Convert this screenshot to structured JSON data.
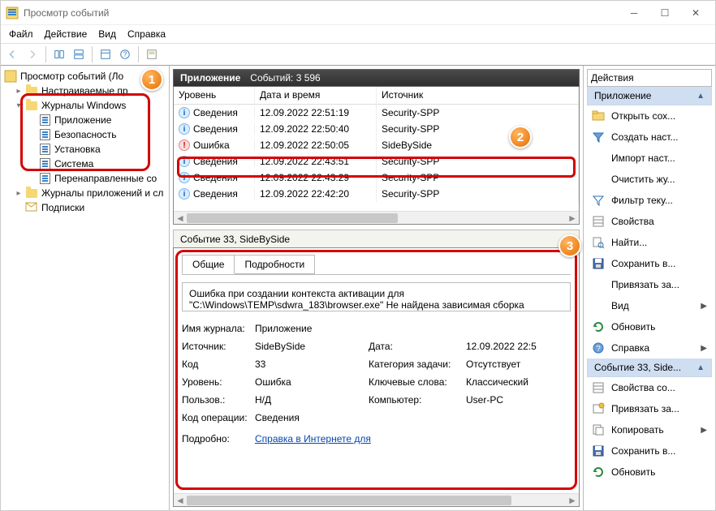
{
  "window": {
    "title": "Просмотр событий"
  },
  "menu": [
    "Файл",
    "Действие",
    "Вид",
    "Справка"
  ],
  "tree": {
    "root": "Просмотр событий (Ло",
    "custom": "Настраиваемые пр",
    "winlogs": "Журналы Windows",
    "items": [
      "Приложение",
      "Безопасность",
      "Установка",
      "Система",
      "Перенаправленные сo"
    ],
    "applogs": "Журналы приложений и сл",
    "subs": "Подписки"
  },
  "center": {
    "title": "Приложение",
    "event_count": "Событий: 3 596",
    "columns": [
      "Уровень",
      "Дата и время",
      "Источник"
    ],
    "rows": [
      {
        "level": "Сведения",
        "lvl": "info",
        "dt": "12.09.2022 22:51:19",
        "src": "Security-SPP"
      },
      {
        "level": "Сведения",
        "lvl": "info",
        "dt": "12.09.2022 22:50:40",
        "src": "Security-SPP"
      },
      {
        "level": "Ошибка",
        "lvl": "err",
        "dt": "12.09.2022 22:50:05",
        "src": "SideBySide"
      },
      {
        "level": "Сведения",
        "lvl": "info",
        "dt": "12.09.2022 22:43:51",
        "src": "Security-SPP"
      },
      {
        "level": "Сведения",
        "lvl": "info",
        "dt": "12.09.2022 22:43:29",
        "src": "Security-SPP"
      },
      {
        "level": "Сведения",
        "lvl": "info",
        "dt": "12.09.2022 22:42:20",
        "src": "Security-SPP"
      }
    ],
    "detail_title": "Событие 33, SideBySide",
    "tabs": [
      "Общие",
      "Подробности"
    ],
    "err_text": "Ошибка при создании контекста активации для \"C:\\Windows\\TEMP\\sdwra_183\\browser.exe\"  Не найдена зависимая сборка",
    "props": [
      [
        "Имя журнала:",
        "Приложение",
        "",
        ""
      ],
      [
        "Источник:",
        "SideBySide",
        "Дата:",
        "12.09.2022 22:5"
      ],
      [
        "Код",
        "33",
        "Категория задачи:",
        "Отсутствует"
      ],
      [
        "Уровень:",
        "Ошибка",
        "Ключевые слова:",
        "Классический"
      ],
      [
        "Пользов.:",
        "Н/Д",
        "Компьютер:",
        "User-PC"
      ],
      [
        "Код операции:",
        "Сведения",
        "",
        ""
      ]
    ],
    "help_label": "Подробно:",
    "help_link": "Справка в Интернете для"
  },
  "actions": {
    "title": "Действия",
    "sec1": "Приложение",
    "items1": [
      {
        "icon": "folder",
        "label": "Открыть сох..."
      },
      {
        "icon": "filter",
        "label": "Создать наст..."
      },
      {
        "icon": "blank",
        "label": "Импорт наст..."
      },
      {
        "icon": "blank",
        "label": "Очистить жу..."
      },
      {
        "icon": "filter2",
        "label": "Фильтр теку..."
      },
      {
        "icon": "props",
        "label": "Свойства"
      },
      {
        "icon": "find",
        "label": "Найти..."
      },
      {
        "icon": "save",
        "label": "Сохранить в..."
      },
      {
        "icon": "blank",
        "label": "Привязать за..."
      },
      {
        "icon": "blank",
        "label": "Вид",
        "sub": true
      },
      {
        "icon": "refresh",
        "label": "Обновить"
      },
      {
        "icon": "help",
        "label": "Справка",
        "sub": true
      }
    ],
    "sec2": "Событие 33, Side...",
    "items2": [
      {
        "icon": "props",
        "label": "Свойства со..."
      },
      {
        "icon": "attach",
        "label": "Привязать за..."
      },
      {
        "icon": "copy",
        "label": "Копировать",
        "sub": true
      },
      {
        "icon": "save",
        "label": "Сохранить в..."
      },
      {
        "icon": "refresh",
        "label": "Обновить"
      }
    ]
  }
}
